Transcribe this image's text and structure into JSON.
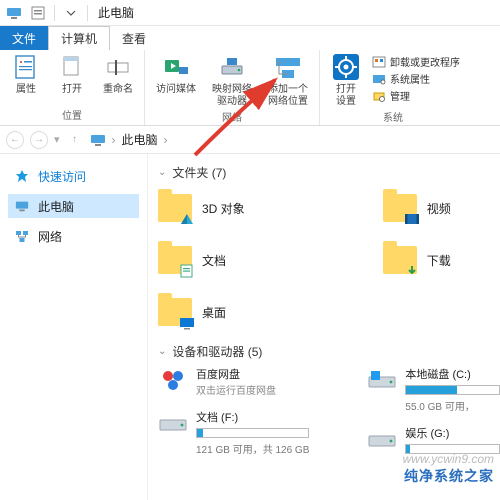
{
  "title": "此电脑",
  "tabs": {
    "file": "文件",
    "computer": "计算机",
    "view": "查看"
  },
  "ribbon": {
    "loc": {
      "props": "属性",
      "open": "打开",
      "rename": "重命名",
      "cap": "位置"
    },
    "net": {
      "media": "访问媒体",
      "mapdrv1": "映射网络",
      "mapdrv2": "驱动器",
      "addloc1": "添加一个",
      "addloc2": "网络位置",
      "cap": "网络"
    },
    "sys": {
      "settings": "打开\n设置",
      "uninstall": "卸载或更改程序",
      "sysprops": "系统属性",
      "manage": "管理",
      "cap": "系统"
    }
  },
  "breadcrumb": {
    "root": "此电脑"
  },
  "nav": {
    "quick": "快速访问",
    "thispc": "此电脑",
    "network": "网络"
  },
  "sections": {
    "folders_h": "文件夹 (7)",
    "drives_h": "设备和驱动器 (5)"
  },
  "folders": {
    "f1": "3D 对象",
    "f2": "文档",
    "f3": "桌面",
    "f4": "视频",
    "f5": "下载"
  },
  "drives": {
    "baidu_name": "百度网盘",
    "baidu_sub": "双击运行百度网盘",
    "f_name": "文档 (F:)",
    "f_stat": "121 GB 可用，共 126 GB",
    "c_name": "本地磁盘 (C:)",
    "c_stat": "55.0 GB 可用，",
    "g_name": "娱乐 (G:)",
    "g_stat": ""
  },
  "wm": {
    "a": "www.ycwin9.com",
    "b": "纯净系统之家"
  }
}
